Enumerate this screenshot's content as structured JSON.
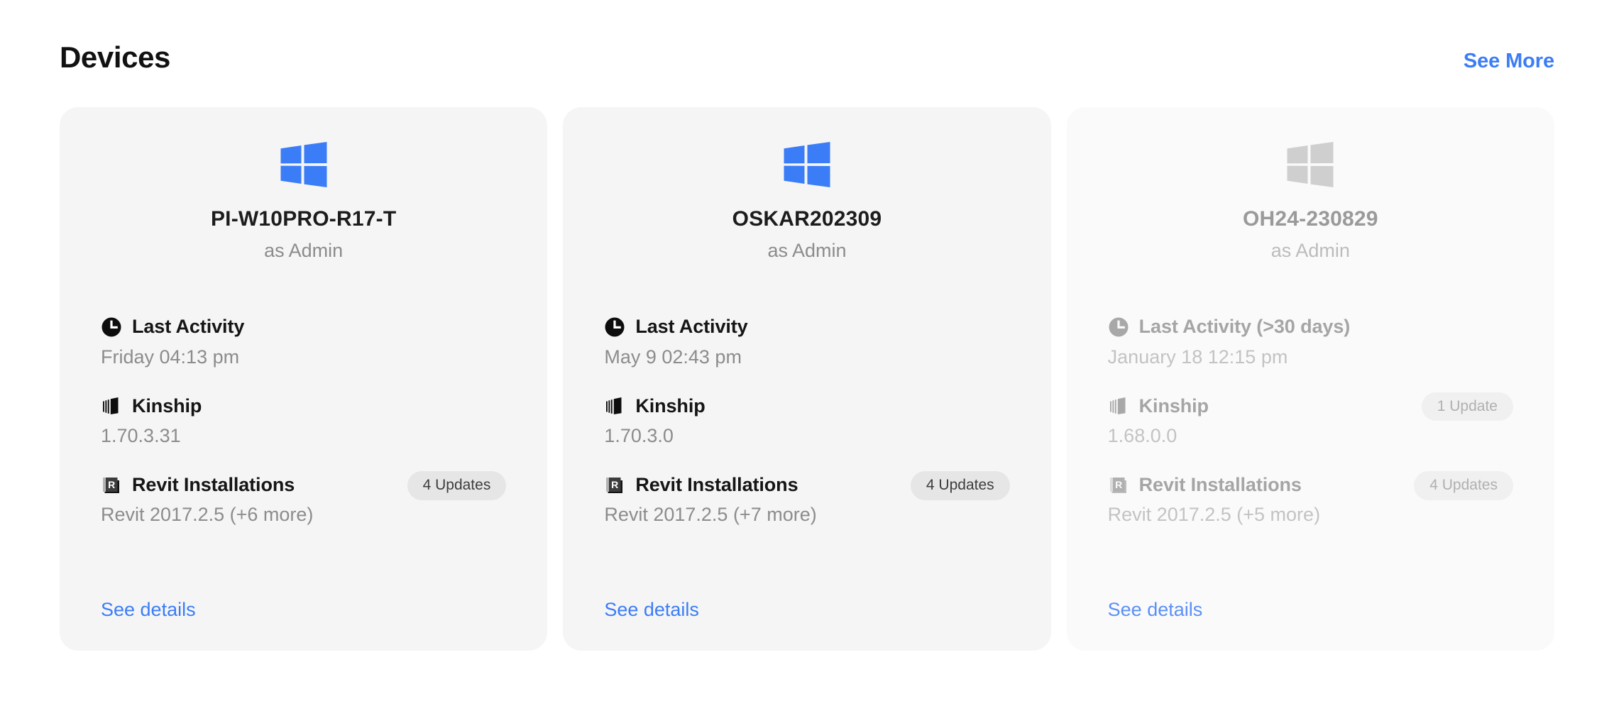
{
  "header": {
    "title": "Devices",
    "see_more_label": "See More",
    "link_color": "#3b7df6"
  },
  "labels": {
    "last_activity": "Last Activity",
    "last_activity_stale": "Last Activity (>30 days)",
    "kinship": "Kinship",
    "revit": "Revit Installations",
    "see_details": "See details"
  },
  "icons": {
    "os": "windows-logo-icon",
    "activity": "clock-icon",
    "kinship": "kinship-book-icon",
    "revit": "revit-r-icon"
  },
  "colors": {
    "card_bg": "#f5f5f5",
    "card_bg_inactive": "#fafafa",
    "windows_blue": "#3b7df6",
    "windows_gray": "#cfcfcf",
    "badge_bg": "#e6e6e6"
  },
  "cards": [
    {
      "name": "PI-W10PRO-R17-T",
      "role": "as Admin",
      "inactive": false,
      "activity": {
        "label": "Last Activity",
        "value": "Friday 04:13 pm",
        "badge": ""
      },
      "kinship": {
        "label": "Kinship",
        "value": "1.70.3.31",
        "badge": ""
      },
      "revit": {
        "label": "Revit Installations",
        "value": "Revit 2017.2.5 (+6 more)",
        "badge": "4 Updates"
      },
      "see_details": "See details"
    },
    {
      "name": "OSKAR202309",
      "role": "as Admin",
      "inactive": false,
      "activity": {
        "label": "Last Activity",
        "value": "May 9 02:43 pm",
        "badge": ""
      },
      "kinship": {
        "label": "Kinship",
        "value": "1.70.3.0",
        "badge": ""
      },
      "revit": {
        "label": "Revit Installations",
        "value": "Revit 2017.2.5 (+7 more)",
        "badge": "4 Updates"
      },
      "see_details": "See details"
    },
    {
      "name": "OH24-230829",
      "role": "as Admin",
      "inactive": true,
      "activity": {
        "label": "Last Activity (>30 days)",
        "value": "January 18 12:15 pm",
        "badge": ""
      },
      "kinship": {
        "label": "Kinship",
        "value": "1.68.0.0",
        "badge": "1 Update"
      },
      "revit": {
        "label": "Revit Installations",
        "value": "Revit 2017.2.5 (+5 more)",
        "badge": "4 Updates"
      },
      "see_details": "See details"
    }
  ]
}
